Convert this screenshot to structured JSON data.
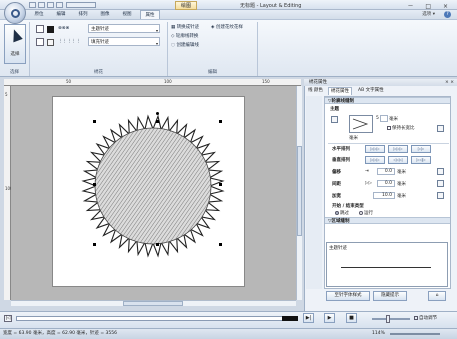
{
  "window": {
    "title": "无标题 - Layout & Editing",
    "context_tab": "绘图",
    "controls": "－ □ ×"
  },
  "menu": {
    "tabs": [
      "原位",
      "编辑",
      "排列",
      "图像",
      "视图",
      "属性"
    ],
    "active_tab": "属性",
    "style_label": "选项 ▾",
    "help": "?"
  },
  "ribbon": {
    "groups": {
      "select": "选择",
      "stitch": "绣花",
      "edit": "编辑"
    },
    "select_button": "选择",
    "line_type_dropdown": "主题针迹",
    "fill_type_dropdown": "填充针迹",
    "edit_items": [
      "转换成针迹",
      "创建花纹花样",
      "轮廓线转换",
      "创建编辑线"
    ]
  },
  "ruler": {
    "top_ticks": [
      "",
      "50",
      "100",
      "150"
    ],
    "left_ticks": [
      "5",
      "100"
    ]
  },
  "panel": {
    "title": "绣花属性",
    "close": "× ×",
    "tabs": [
      "线 颜色",
      "绣花属性",
      "AB 文字属性"
    ],
    "section_outline": "▽轮廓线缝制",
    "main_title": "主题",
    "size_value": "5",
    "unit_mm": "毫米",
    "keep_ratio": "保持长宽比",
    "rows": {
      "horizontal": "水平排列",
      "vertical": "垂直排列",
      "offset": "偏移",
      "spacing": "间距",
      "density": "加宽"
    },
    "values": {
      "offset": "0.0",
      "spacing": "0.0",
      "density": "10.0"
    },
    "start_end": "开始 / 结束类型",
    "radio_skip": "跳过",
    "radio_run": "运行",
    "section_region": "▽区域缝制",
    "preview_label": "主题针迹",
    "btn_save": "至针字体样式",
    "btn_hide": "隐藏提示",
    "btn_icon": "⌂"
  },
  "status": {
    "text": "宽度 = 63.90 毫米，高度 = 62.90 毫米，针迹 = 3556",
    "zoom": "114%"
  },
  "player": {
    "play": "▶",
    "next": "▶|",
    "stop": "■",
    "auto": "自动调节"
  }
}
